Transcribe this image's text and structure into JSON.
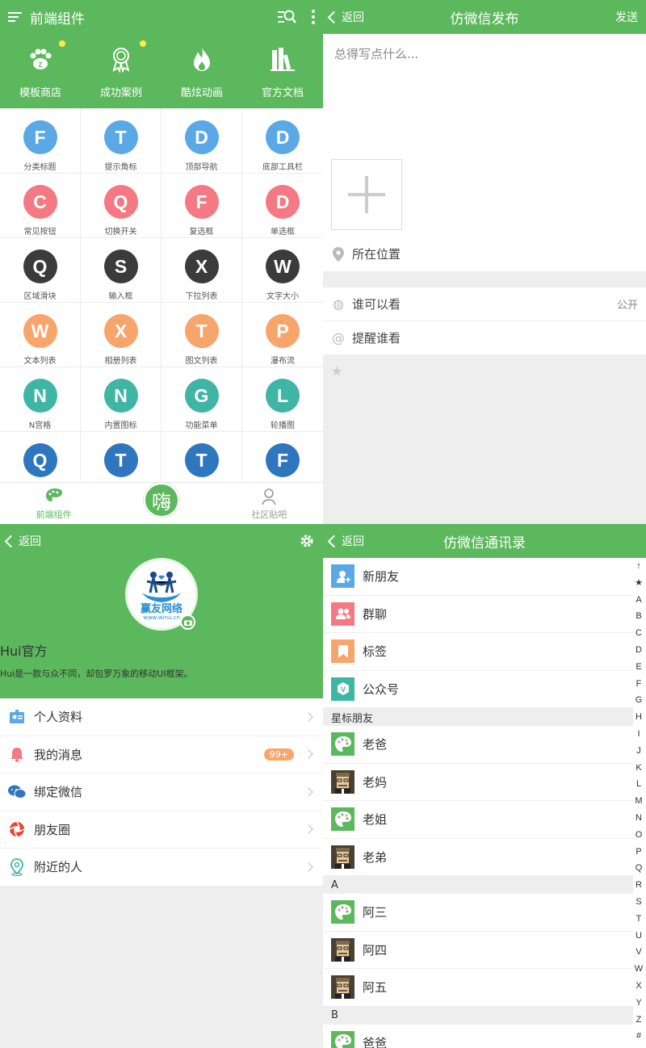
{
  "panel1": {
    "title": "前端组件",
    "shortcuts": [
      {
        "label": "模板商店",
        "icon": "paw-icon",
        "dot": true
      },
      {
        "label": "成功案例",
        "icon": "medal-icon",
        "dot": true
      },
      {
        "label": "酷炫动画",
        "icon": "fire-icon",
        "dot": false
      },
      {
        "label": "官方文档",
        "icon": "books-icon",
        "dot": false
      }
    ],
    "grid": [
      {
        "letter": "F",
        "label": "分类标题",
        "color": "#5aa9e6"
      },
      {
        "letter": "T",
        "label": "提示角标",
        "color": "#5aa9e6"
      },
      {
        "letter": "D",
        "label": "顶部导航",
        "color": "#5aa9e6"
      },
      {
        "letter": "D",
        "label": "底部工具栏",
        "color": "#5aa9e6"
      },
      {
        "letter": "C",
        "label": "常见按钮",
        "color": "#f47983"
      },
      {
        "letter": "Q",
        "label": "切换开关",
        "color": "#f47983"
      },
      {
        "letter": "F",
        "label": "复选框",
        "color": "#f47983"
      },
      {
        "letter": "D",
        "label": "单选框",
        "color": "#f47983"
      },
      {
        "letter": "Q",
        "label": "区域滑块",
        "color": "#3b3b3b"
      },
      {
        "letter": "S",
        "label": "输入框",
        "color": "#3b3b3b"
      },
      {
        "letter": "X",
        "label": "下拉列表",
        "color": "#3b3b3b"
      },
      {
        "letter": "W",
        "label": "文字大小",
        "color": "#3b3b3b"
      },
      {
        "letter": "W",
        "label": "文本列表",
        "color": "#f8a56b"
      },
      {
        "letter": "X",
        "label": "相册列表",
        "color": "#f8a56b"
      },
      {
        "letter": "T",
        "label": "图文列表",
        "color": "#f8a56b"
      },
      {
        "letter": "P",
        "label": "瀑布流",
        "color": "#f8a56b"
      },
      {
        "letter": "N",
        "label": "N宫格",
        "color": "#3fb5a6"
      },
      {
        "letter": "N",
        "label": "内置图标",
        "color": "#3fb5a6"
      },
      {
        "letter": "G",
        "label": "功能菜单",
        "color": "#3fb5a6"
      },
      {
        "letter": "L",
        "label": "轮播图",
        "color": "#3fb5a6"
      },
      {
        "letter": "Q",
        "label": "",
        "color": "#2e76bd"
      },
      {
        "letter": "T",
        "label": "",
        "color": "#2e76bd"
      },
      {
        "letter": "T",
        "label": "",
        "color": "#2e76bd"
      },
      {
        "letter": "F",
        "label": "",
        "color": "#2e76bd"
      }
    ],
    "tabs": {
      "left": "前端组件",
      "center": "嗨",
      "right": "社区贴吧"
    }
  },
  "panel2": {
    "back": "返回",
    "title": "仿微信发布",
    "send": "发送",
    "placeholder": "总得写点什么...",
    "location": "所在位置",
    "options": [
      {
        "label": "谁可以看",
        "value": "公开",
        "icon": "globe-icon"
      },
      {
        "label": "提醒谁看",
        "value": "",
        "icon": "at-icon"
      }
    ]
  },
  "panel3": {
    "back": "返回",
    "avatar_text": "赢友网络",
    "avatar_sub": "www.winu.cn",
    "name": "Hui官方",
    "desc": "Hui是一款与众不同，却包罗万象的移动UI框架。",
    "menu": [
      {
        "label": "个人资料",
        "icon": "profile-card-icon",
        "badge": ""
      },
      {
        "label": "我的消息",
        "icon": "bell-icon",
        "badge": "99+"
      },
      {
        "label": "绑定微信",
        "icon": "wechat-icon",
        "badge": ""
      },
      {
        "label": "朋友圈",
        "icon": "aperture-icon",
        "badge": ""
      },
      {
        "label": "附近的人",
        "icon": "location-icon",
        "badge": ""
      }
    ]
  },
  "panel4": {
    "back": "返回",
    "title": "仿微信通讯录",
    "top_items": [
      {
        "label": "新朋友",
        "color": "#5aa9e6",
        "icon": "add-friend-icon"
      },
      {
        "label": "群聊",
        "color": "#f47983",
        "icon": "group-icon"
      },
      {
        "label": "标签",
        "color": "#f8a56b",
        "icon": "bookmark-icon"
      },
      {
        "label": "公众号",
        "color": "#3fb5a6",
        "icon": "official-account-icon"
      }
    ],
    "starred_header": "星标朋友",
    "starred": [
      {
        "name": "老爸",
        "avatar": "palette"
      },
      {
        "name": "老妈",
        "avatar": "face"
      },
      {
        "name": "老姐",
        "avatar": "palette"
      },
      {
        "name": "老弟",
        "avatar": "face"
      }
    ],
    "a_header": "A",
    "a_list": [
      {
        "name": "阿三",
        "avatar": "palette"
      },
      {
        "name": "阿四",
        "avatar": "face"
      },
      {
        "name": "阿五",
        "avatar": "face"
      }
    ],
    "b_header": "B",
    "b_list": [
      {
        "name": "爸爸",
        "avatar": "palette"
      }
    ],
    "index": [
      "↑",
      "★",
      "A",
      "B",
      "C",
      "D",
      "E",
      "F",
      "G",
      "H",
      "I",
      "J",
      "K",
      "L",
      "M",
      "N",
      "O",
      "P",
      "Q",
      "R",
      "S",
      "T",
      "U",
      "V",
      "W",
      "X",
      "Y",
      "Z",
      "#"
    ]
  }
}
